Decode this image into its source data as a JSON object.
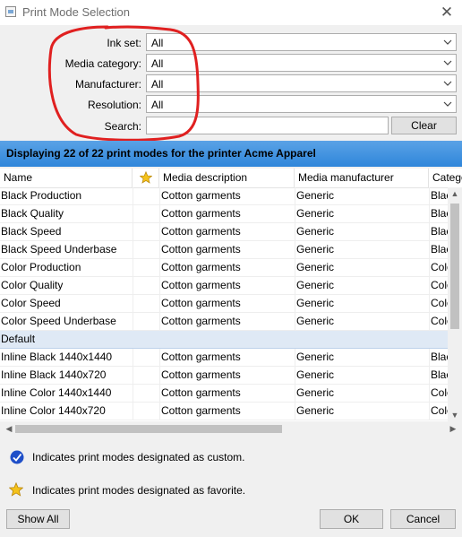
{
  "window": {
    "title": "Print Mode Selection",
    "icon": "app-window-icon",
    "close_icon": "close-icon"
  },
  "filters": {
    "ink_set": {
      "label": "Ink set:",
      "value": "All"
    },
    "media_category": {
      "label": "Media category:",
      "value": "All"
    },
    "manufacturer": {
      "label": "Manufacturer:",
      "value": "All"
    },
    "resolution": {
      "label": "Resolution:",
      "value": "All"
    },
    "search": {
      "label": "Search:",
      "value": ""
    },
    "clear_label": "Clear"
  },
  "banner": "Displaying 22 of 22 print modes for the printer Acme Apparel",
  "table": {
    "columns": [
      "Name",
      "",
      "Media description",
      "Media manufacturer",
      "Catego"
    ],
    "rows": [
      {
        "name": "Black Production",
        "media": "Cotton garments",
        "manufacturer": "Generic",
        "category": "Blac"
      },
      {
        "name": "Black Quality",
        "media": "Cotton garments",
        "manufacturer": "Generic",
        "category": "Blac"
      },
      {
        "name": "Black Speed",
        "media": "Cotton garments",
        "manufacturer": "Generic",
        "category": "Blac"
      },
      {
        "name": "Black Speed Underbase",
        "media": "Cotton garments",
        "manufacturer": "Generic",
        "category": "Blac"
      },
      {
        "name": "Color Production",
        "media": "Cotton garments",
        "manufacturer": "Generic",
        "category": "Colo"
      },
      {
        "name": "Color Quality",
        "media": "Cotton garments",
        "manufacturer": "Generic",
        "category": "Colo"
      },
      {
        "name": "Color Speed",
        "media": "Cotton garments",
        "manufacturer": "Generic",
        "category": "Colo"
      },
      {
        "name": "Color Speed Underbase",
        "media": "Cotton garments",
        "manufacturer": "Generic",
        "category": "Colo"
      },
      {
        "group": "Default"
      },
      {
        "name": "Inline Black 1440x1440",
        "media": "Cotton garments",
        "manufacturer": "Generic",
        "category": "Blac"
      },
      {
        "name": "Inline Black 1440x720",
        "media": "Cotton garments",
        "manufacturer": "Generic",
        "category": "Blac"
      },
      {
        "name": "Inline Color 1440x1440",
        "media": "Cotton garments",
        "manufacturer": "Generic",
        "category": "Colo"
      },
      {
        "name": "Inline Color 1440x720",
        "media": "Cotton garments",
        "manufacturer": "Generic",
        "category": "Colo"
      }
    ]
  },
  "legend": {
    "custom": "Indicates print modes designated as custom.",
    "favorite": "Indicates print modes designated as favorite."
  },
  "buttons": {
    "show_all": "Show All",
    "ok": "OK",
    "cancel": "Cancel"
  },
  "colors": {
    "banner": "#3a8fdd",
    "annotation": "#e02020",
    "group_row": "#dfe9f5"
  }
}
